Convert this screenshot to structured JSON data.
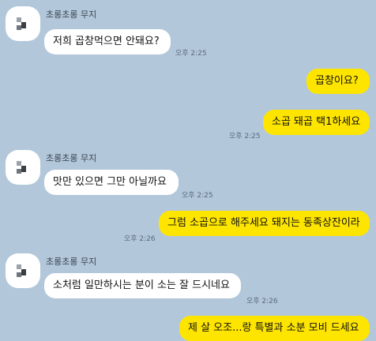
{
  "messages": [
    {
      "sender": "초롱초롱 무지",
      "text": "저희 곱창먹으면 안돼요?",
      "time": "오후 2:25"
    },
    {
      "text": "곱창이요?"
    },
    {
      "text": "소곱 돼곱 택1하세요",
      "time": "오후 2:25"
    },
    {
      "sender": "초롱초롱 무지",
      "text": "맛만 있으면 그만 아닐까요",
      "time": "오후 2:25"
    },
    {
      "text": "그럼 소곱으로 해주세요 돼지는 동족상잔이라",
      "time": "오후 2:26"
    },
    {
      "sender": "초롱초롱 무지",
      "text": "소처럼 일만하시는 분이 소는 잘 드시네요",
      "time": "오후 2:26"
    },
    {
      "text": "제 살 오조...랑 특별과 소분 모비 드세요"
    }
  ],
  "colors": {
    "background": "#b2c7da",
    "incoming": "#ffffff",
    "outgoing": "#fee500"
  }
}
